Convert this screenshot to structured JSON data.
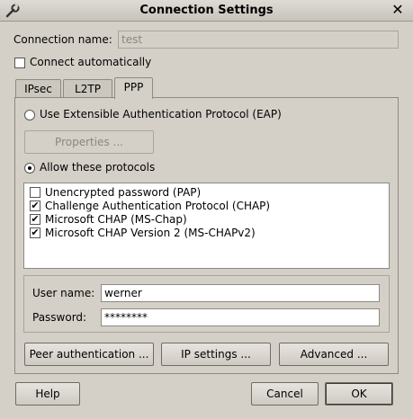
{
  "window": {
    "title": "Connection Settings",
    "app_icon": "wrench-icon",
    "close_label": "✕"
  },
  "connection": {
    "name_label": "Connection name:",
    "name_value": "test",
    "auto_label": "Connect automatically",
    "auto_checked": false
  },
  "tabs": [
    {
      "label": "IPsec",
      "active": false
    },
    {
      "label": "L2TP",
      "active": false
    },
    {
      "label": "PPP",
      "active": true
    }
  ],
  "ppp": {
    "eap_label": "Use Extensible Authentication Protocol (EAP)",
    "eap_selected": false,
    "properties_label": "Properties ...",
    "allow_label": "Allow these protocols",
    "allow_selected": true,
    "protocols": [
      {
        "label": "Unencrypted password (PAP)",
        "checked": false
      },
      {
        "label": "Challenge Authentication Protocol (CHAP)",
        "checked": true
      },
      {
        "label": "Microsoft CHAP (MS-Chap)",
        "checked": true
      },
      {
        "label": "Microsoft CHAP Version 2 (MS-CHAPv2)",
        "checked": true
      }
    ],
    "username_label": "User name:",
    "username_value": "werner",
    "password_label": "Password:",
    "password_value": "********",
    "peer_auth_label": "Peer authentication ...",
    "ip_settings_label": "IP settings ...",
    "advanced_label": "Advanced ..."
  },
  "footer": {
    "help_label": "Help",
    "cancel_label": "Cancel",
    "ok_label": "OK"
  }
}
